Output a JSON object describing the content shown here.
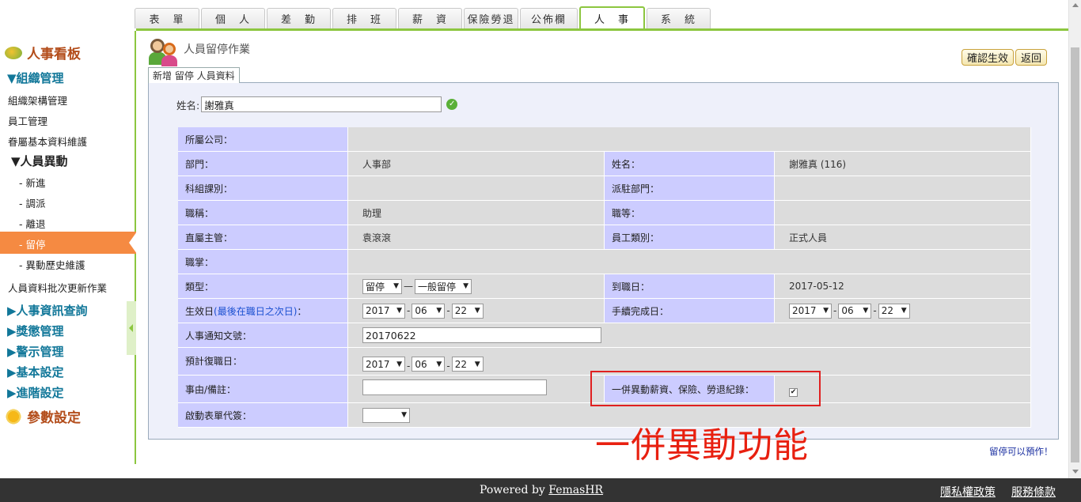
{
  "tabs": [
    "表　單",
    "個　人",
    "差　勤",
    "排　班",
    "薪　資",
    "保險勞退",
    "公佈欄",
    "人　事",
    "系　統"
  ],
  "active_tab": "人　事",
  "sidebar": {
    "dashboard": "人事看板",
    "org_group": "▼組織管理",
    "org_items": [
      "組織架構管理",
      "員工管理",
      "眷屬基本資料維護"
    ],
    "change_group": "▼人員異動",
    "change_items": [
      "- 新進",
      "- 調派",
      "- 離退",
      "- 留停",
      "- 異動歷史維護"
    ],
    "active_item": "- 留停",
    "batch": "人員資料批次更新作業",
    "groups": [
      "▶人事資訊查詢",
      "▶獎懲管理",
      "▶警示管理",
      "▶基本設定",
      "▶進階設定"
    ],
    "params": "參數設定"
  },
  "page": {
    "title": "人員留停作業",
    "confirm_button": "確認生效",
    "back_button": "返回",
    "subtab": "新增 留停 人員資料",
    "name_label": "姓名:",
    "name_value": "謝雅真",
    "ok_icon": "check-circle-icon"
  },
  "form": {
    "company_label": "所屬公司：",
    "dept_label": "部門：",
    "dept_value": "人事部",
    "name_label": "姓名：",
    "name_value": "謝雅真 (116)",
    "section_label": "科組課別：",
    "station_label": "派駐部門：",
    "title_label": "職稱：",
    "title_value": "助理",
    "grade_label": "職等：",
    "supervisor_label": "直屬主管：",
    "supervisor_value": "袁滾滾",
    "emp_type_label": "員工類別：",
    "emp_type_value": "正式人員",
    "duty_label": "職掌：",
    "type_label": "類型：",
    "type_value1": "留停",
    "type_value2": "一般留停",
    "hire_label": "到職日：",
    "hire_value": "2017-05-12",
    "effective_label": "生效日",
    "effective_note": "(最後在職日之次日)",
    "effective_colon": "：",
    "eff_year": "2017",
    "eff_month": "06",
    "eff_day": "22",
    "proc_label": "手續完成日：",
    "proc_year": "2017",
    "proc_month": "06",
    "proc_day": "22",
    "notice_label": "人事通知文號：",
    "notice_value": "20170622",
    "return_label": "預計復職日：",
    "ret_year": "2017",
    "ret_month": "06",
    "ret_day": "22",
    "reason_label": "事由/備註：",
    "sync_label": "一併異動薪資、保險、勞退紀錄：",
    "sync_checked": "✔",
    "sign_label": "啟動表單代簽："
  },
  "annotation": "一併異動功能",
  "note": "留停可以預作！",
  "footer": {
    "powered": "Powered by ",
    "brand": "FemasHR",
    "privacy": "隱私權政策",
    "terms": "服務條款"
  },
  "colors": {
    "accent_green": "#8cc63f",
    "active_orange": "#f58a42",
    "label_purple": "#ccccff",
    "highlight_red": "#e02020"
  }
}
